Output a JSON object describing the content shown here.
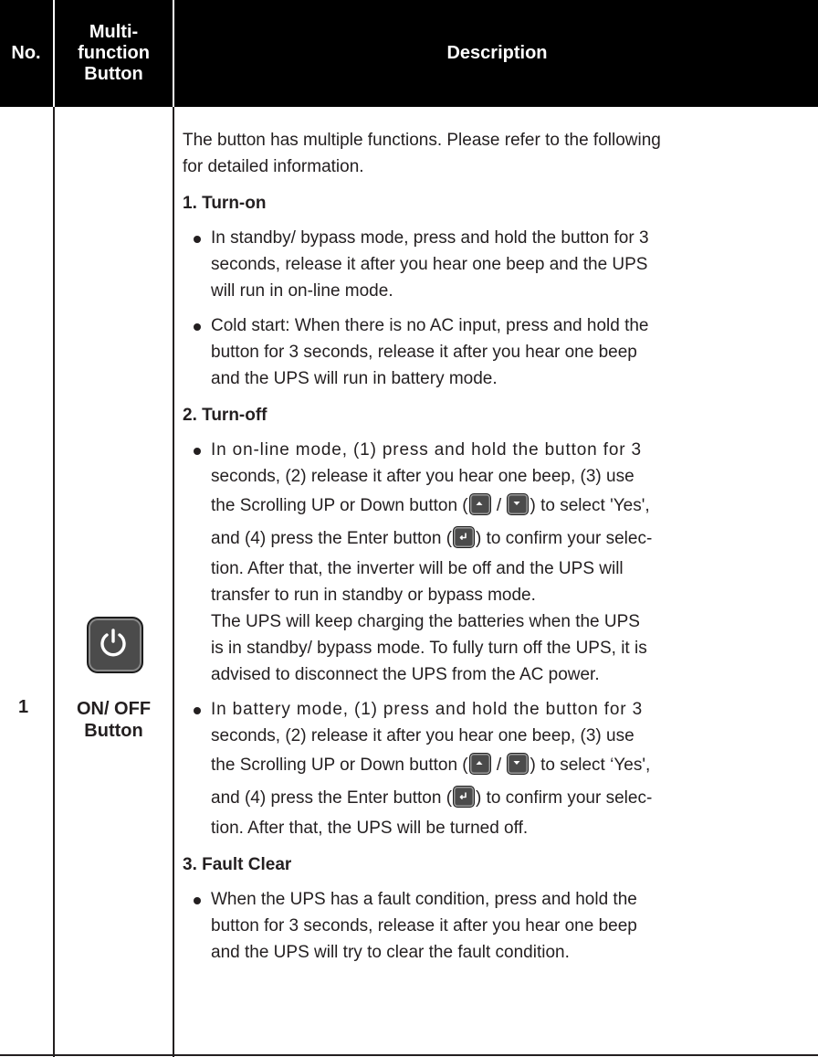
{
  "header": {
    "no": "No.",
    "multifunction": [
      "Multi-",
      "function",
      "Button"
    ],
    "description": "Description"
  },
  "row": {
    "no": "1",
    "button_icon": "power-icon",
    "button_name": [
      "ON/ OFF",
      "Button"
    ]
  },
  "description": {
    "intro": [
      "The button has multiple functions. Please refer to the following",
      "for detailed information."
    ],
    "sections": [
      {
        "heading": "1. Turn-on",
        "bullets": [
          [
            "In standby/ bypass mode, press and hold the button for 3",
            "seconds, release it after you hear one beep and the UPS",
            "will run in on-line mode."
          ],
          [
            "Cold start: When there is no AC input, press and hold the",
            "button for 3 seconds, release it after you hear one beep",
            "and the UPS will run in battery mode."
          ]
        ]
      },
      {
        "heading": "2. Turn-off",
        "online": {
          "l1": "In on-line mode, (1) press and hold the button for 3",
          "l2": "seconds, (2) release it after you hear one beep, (3) use",
          "l3_pre": "the Scrolling UP or Down button (",
          "l3_sep": "/",
          "l3_post": ") to select 'Yes',",
          "l4_pre": "and (4) press the Enter button (",
          "l4_post": ") to confirm your selec-",
          "l5": "tion. After that, the inverter will be off and the UPS will",
          "l6": "transfer to run in standby or bypass mode."
        },
        "note": [
          "The UPS will keep charging the batteries when the UPS",
          "is in standby/ bypass mode. To fully turn off the UPS, it is",
          "advised to disconnect the UPS from the AC power."
        ],
        "battery": {
          "l1": "In battery mode, (1) press and hold the button for 3",
          "l2": "seconds, (2) release it after you hear one beep, (3) use",
          "l3_pre": "the Scrolling UP or Down button (",
          "l3_sep": "/",
          "l3_post": ") to select  ‘Yes',",
          "l4_pre": "and (4) press the Enter button (",
          "l4_post": ") to confirm your selec-",
          "l5": "tion. After that, the UPS will be turned off."
        }
      },
      {
        "heading": "3.  Fault Clear",
        "bullets": [
          [
            "When the UPS has a fault condition, press and hold the",
            "button for 3 seconds, release it after you hear one beep",
            "and the UPS will try to clear the fault condition."
          ]
        ]
      }
    ],
    "icons": {
      "up": "scroll-up-icon",
      "down": "scroll-down-icon",
      "enter": "enter-icon"
    }
  }
}
